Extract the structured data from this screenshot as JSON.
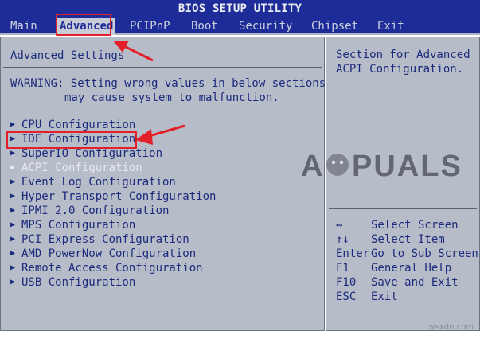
{
  "window": {
    "title": "BIOS SETUP UTILITY"
  },
  "menu": {
    "items": [
      {
        "label": "Main"
      },
      {
        "label": "Advanced"
      },
      {
        "label": "PCIPnP"
      },
      {
        "label": "Boot"
      },
      {
        "label": "Security"
      },
      {
        "label": "Chipset"
      },
      {
        "label": "Exit"
      }
    ],
    "selected": "Advanced"
  },
  "main": {
    "title": "Advanced Settings",
    "warning_line1": "WARNING: Setting wrong values in below sections",
    "warning_line2": "may cause system to malfunction.",
    "options": [
      {
        "label": "CPU Configuration"
      },
      {
        "label": "IDE Configuration"
      },
      {
        "label": "SuperIO Configuration"
      },
      {
        "label": "ACPI Configuration"
      },
      {
        "label": "Event Log Configuration"
      },
      {
        "label": "Hyper Transport Configuration"
      },
      {
        "label": "IPMI 2.0 Configuration"
      },
      {
        "label": "MPS Configuration"
      },
      {
        "label": "PCI Express Configuration"
      },
      {
        "label": "AMD PowerNow Configuration"
      },
      {
        "label": "Remote Access Configuration"
      },
      {
        "label": "USB Configuration"
      }
    ],
    "highlighted_option": "ACPI Configuration"
  },
  "help": {
    "line1": "Section for Advanced",
    "line2": "ACPI Configuration.",
    "keys": [
      {
        "key": "↔",
        "action": "Select Screen"
      },
      {
        "key": "↑↓",
        "action": "Select Item"
      },
      {
        "key": "Enter",
        "action": "Go to Sub Screen"
      },
      {
        "key": "F1",
        "action": "General Help"
      },
      {
        "key": "F10",
        "action": "Save and Exit"
      },
      {
        "key": "ESC",
        "action": "Exit"
      }
    ]
  },
  "watermark": {
    "text": "APPUALS"
  },
  "footer": {
    "text": "wsxdn.com"
  },
  "colors": {
    "bios_blue": "#1d2c98",
    "panel_gray": "#b7bcc9",
    "text_navy": "#1c2a7c",
    "annotation_red": "#e3202a"
  }
}
